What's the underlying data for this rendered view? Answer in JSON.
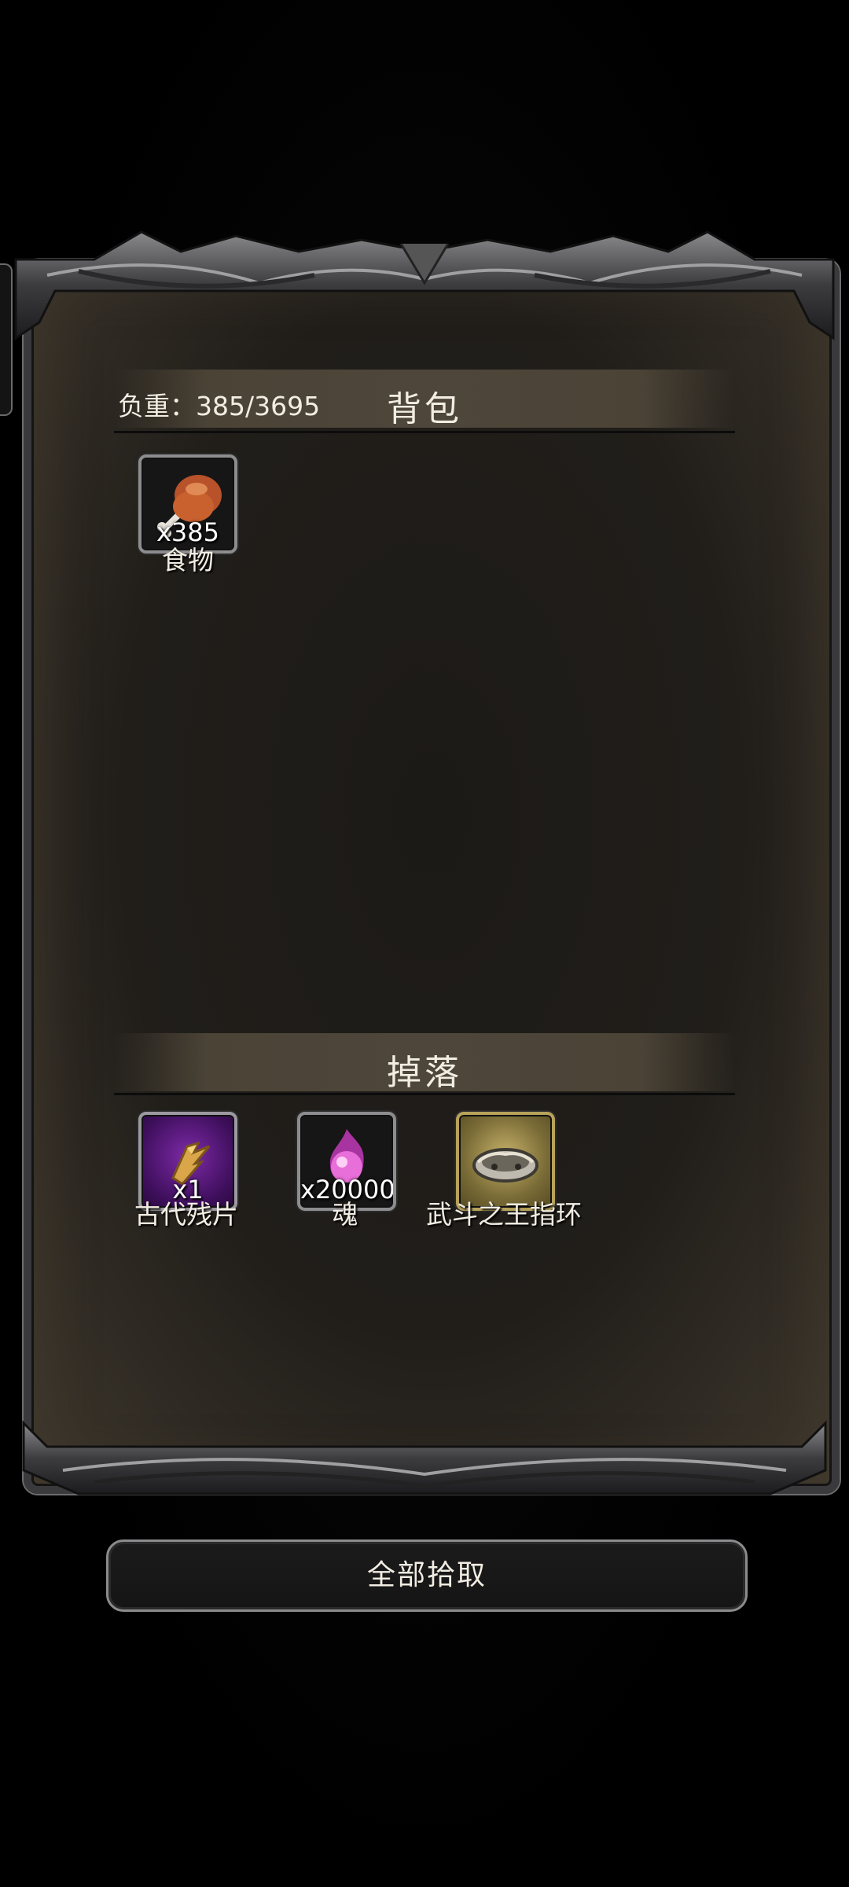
{
  "backpack": {
    "title": "背包",
    "weight_text": "负重：385/3695",
    "items": [
      {
        "name": "食物",
        "qty": "x385",
        "icon": "roast-drumstick-icon"
      }
    ]
  },
  "drops": {
    "title": "掉落",
    "items": [
      {
        "name": "古代残片",
        "qty": "x1",
        "icon": "ancient-fragment-icon"
      },
      {
        "name": "魂",
        "qty": "x20000",
        "icon": "soul-orb-icon"
      },
      {
        "name": "武斗之王指环",
        "qty": "",
        "icon": "ring-icon"
      }
    ]
  },
  "pickup_all_label": "全部拾取",
  "colors": {
    "panel_bg": "#211e1a",
    "header_bar": "#4e463a",
    "purple_slot": "#7e2aa8",
    "gold_slot": "#c8b26a"
  }
}
